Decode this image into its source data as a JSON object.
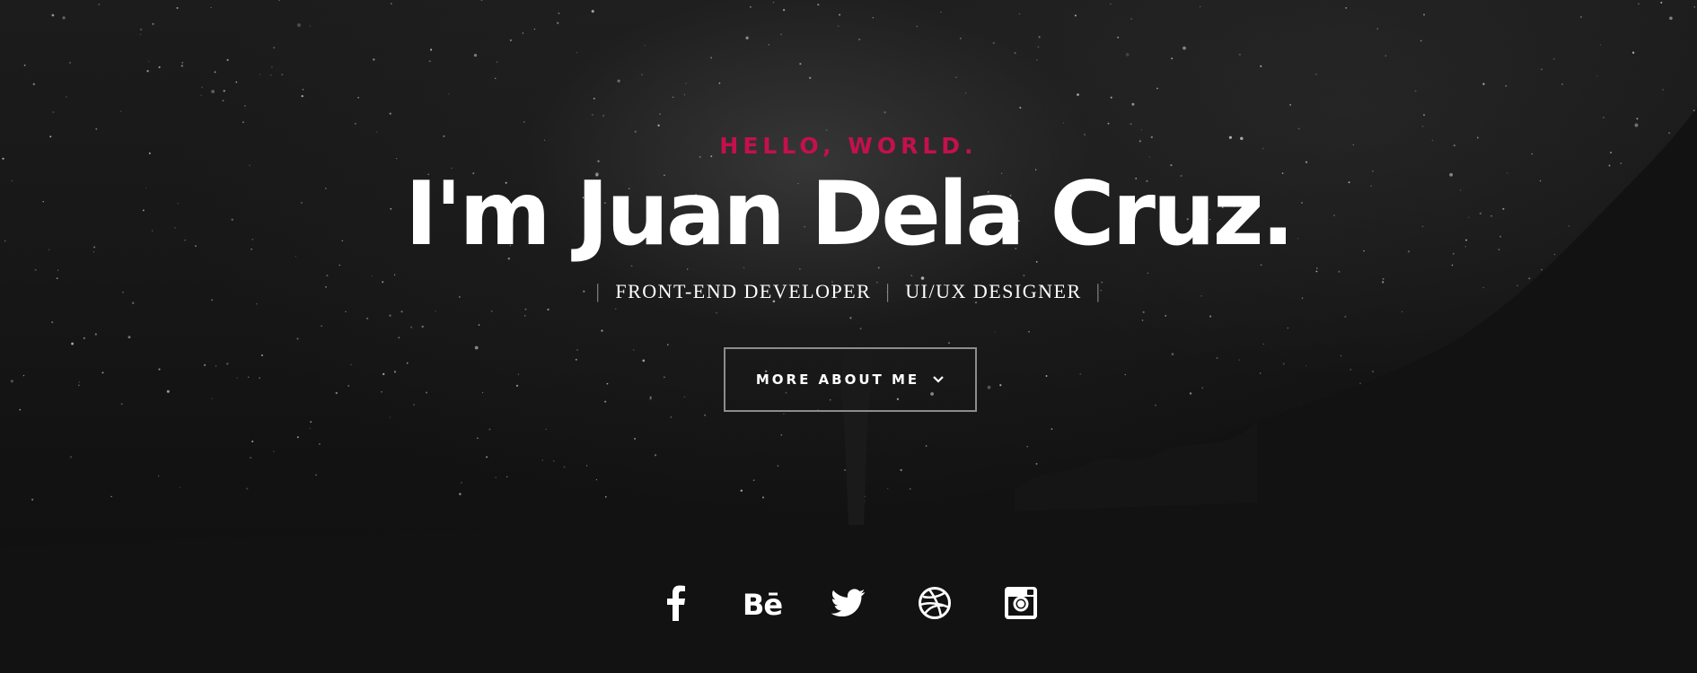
{
  "hero": {
    "greeting": "HELLO, WORLD.",
    "name": "I'm Juan Dela Cruz.",
    "roles": [
      "FRONT-END DEVELOPER",
      "UI/UX DESIGNER"
    ],
    "cta_label": "MORE ABOUT ME"
  },
  "social": [
    {
      "icon": "facebook-icon"
    },
    {
      "icon": "behance-icon",
      "glyph": "Bē"
    },
    {
      "icon": "twitter-icon"
    },
    {
      "icon": "dribbble-icon"
    },
    {
      "icon": "instagram-icon"
    }
  ],
  "colors": {
    "accent": "#c4104e",
    "background": "#111111",
    "text": "#ffffff",
    "button_border": "#8c8c8c"
  }
}
